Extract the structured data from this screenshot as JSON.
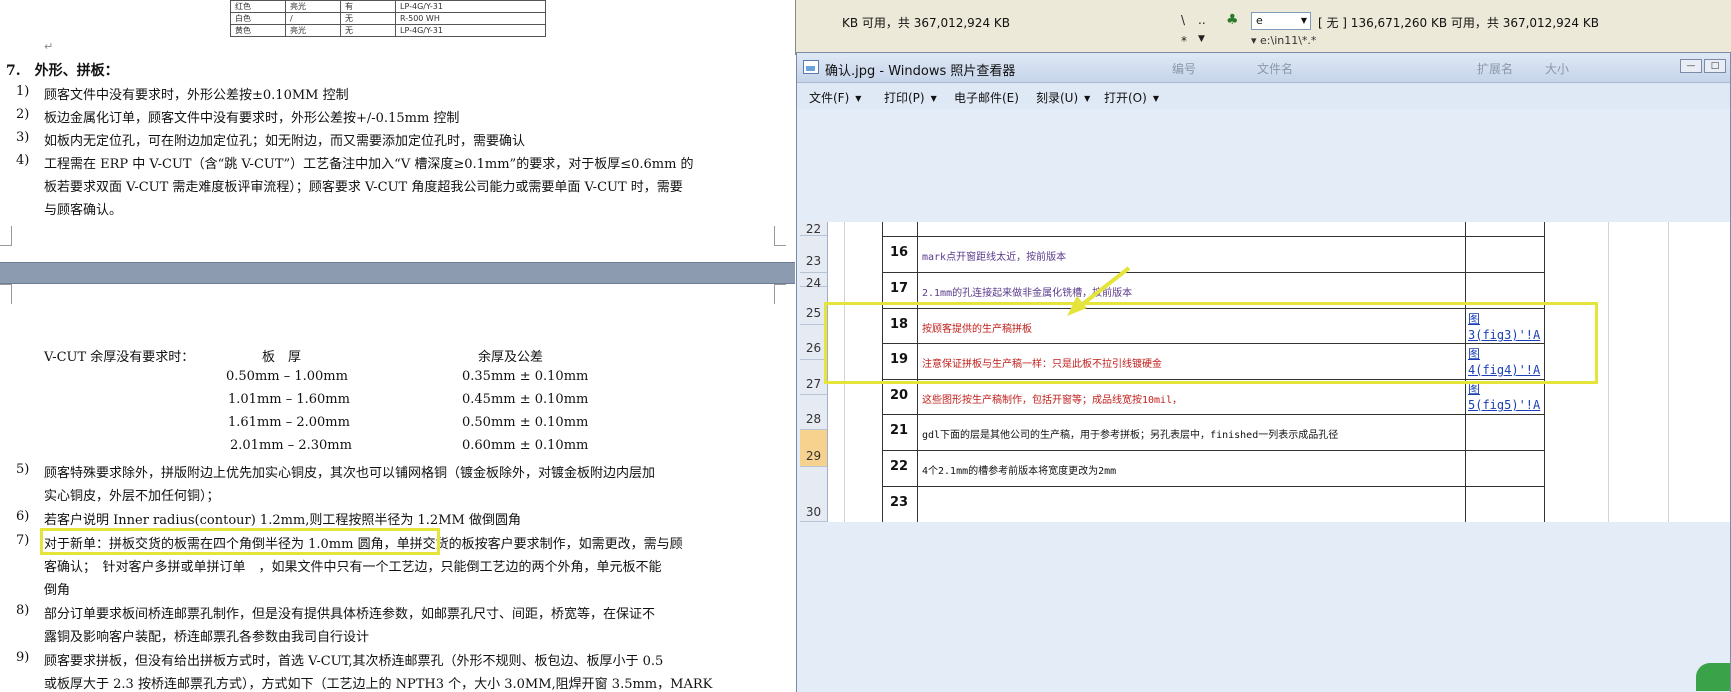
{
  "document": {
    "mini_table_rows": [
      [
        "红色",
        "亮光",
        "有",
        "LP-4G/Y-31"
      ],
      [
        "白色",
        "/",
        "无",
        "R-500 WH"
      ],
      [
        "黄色",
        "亮光",
        "无",
        "LP-4G/Y-31"
      ]
    ],
    "section7_heading": "7.　外形、拼板：",
    "items_top": [
      {
        "num": "1)",
        "text": "顾客文件中没有要求时，外形公差按±0.10MM 控制"
      },
      {
        "num": "2)",
        "text": "板边金属化订单，顾客文件中没有要求时，外形公差按+/-0.15mm 控制"
      },
      {
        "num": "3)",
        "text": "如板内无定位孔，可在附边加定位孔；如无附边，而又需要添加定位孔时，需要确认"
      },
      {
        "num": "4)",
        "text": "工程需在 ERP 中 V-CUT（含“跳 V-CUT”）工艺备注中加入“V 槽深度≥0.1mm”的要求，对于板厚≤0.6mm 的"
      },
      {
        "num": "",
        "text": "板若要求双面 V-CUT 需走难度板评审流程）；顾客要求 V-CUT 角度超我公司能力或需要单面 V-CUT 时，需要"
      },
      {
        "num": "",
        "text": "与顾客确认。"
      }
    ],
    "vcut": {
      "label": "V-CUT 余厚没有要求时：",
      "col1_header": "板　厚",
      "col2_header": "余厚及公差",
      "rows": [
        [
          "0.50mm – 1.00mm",
          "0.35mm ± 0.10mm"
        ],
        [
          "1.01mm – 1.60mm",
          "0.45mm ± 0.10mm"
        ],
        [
          "1.61mm – 2.00mm",
          "0.50mm ± 0.10mm"
        ],
        [
          "2.01mm – 2.30mm",
          "0.60mm ± 0.10mm"
        ]
      ]
    },
    "items_bottom": [
      {
        "num": "5)",
        "text": "顾客特殊要求除外，拼版附边上优先加实心铜皮，其次也可以铺网格铜（镀金板除外，对镀金板附边内层加"
      },
      {
        "num": "",
        "text": "实心铜皮，外层不加任何铜）；"
      },
      {
        "num": "6)",
        "text": "若客户说明 Inner radius(contour) 1.2mm,则工程按照半径为 1.2MM 做倒圆角"
      },
      {
        "num": "7)",
        "text": "对于新单：拼板交货的板需在四个角倒半径为 1.0mm 圆角，单拼交货的板按客户要求制作，如需更改，需与顾"
      },
      {
        "num": "",
        "text": "客确认；　针对客户多拼或单拼订单　，如果文件中只有一个工艺边，只能倒工艺边的两个外角，单元板不能"
      },
      {
        "num": "",
        "text": "倒角"
      },
      {
        "num": "8)",
        "text": "部分订单要求板间桥连邮票孔制作，但是没有提供具体桥连参数，如邮票孔尺寸、间距，桥宽等，在保证不"
      },
      {
        "num": "",
        "text": "露铜及影响客户装配，桥连邮票孔各参数由我司自行设计"
      },
      {
        "num": "9)",
        "text": "顾客要求拼板，但没有给出拼板方式时，首选 V-CUT,其次桥连邮票孔（外形不规则、板包边、板厚小于 0.5"
      },
      {
        "num": "",
        "text": "或板厚大于 2.3 按桥连邮票孔方式），方式如下（工艺边上的 NPTH3 个，大小 3.0MM,阻焊开窗 3.5mm，MARK"
      }
    ]
  },
  "file_manager": {
    "left_status": "KB 可用，共 367,012,924 KB",
    "btn_backslash": "\\",
    "btn_dotdot": "..",
    "btn_star": "*",
    "drive_value": "e",
    "right_status": "[ 无 ] 136,671,260 KB 可用，共 367,012,924 KB",
    "path": "▾ e:\\in11\\*.*"
  },
  "viewer": {
    "title": "确认.jpg - Windows 照片查看器",
    "blurred_tabs": [
      "编号",
      "文件名",
      "扩展名",
      "大小"
    ],
    "menu": [
      {
        "label": "文件(F)",
        "has_caret": true
      },
      {
        "label": "打印(P)",
        "has_caret": true
      },
      {
        "label": "电子邮件(E)",
        "has_caret": false
      },
      {
        "label": "刻录(U)",
        "has_caret": true
      },
      {
        "label": "打开(O)",
        "has_caret": true
      }
    ],
    "win_buttons": [
      "—",
      "□"
    ]
  },
  "sheet": {
    "row_headers": [
      "22",
      "23",
      "24",
      "25",
      "26",
      "27",
      "28",
      "29",
      "30"
    ],
    "active_row": "29",
    "rows": [
      {
        "num": "16",
        "text": "mark点开窗距线太近，按前版本",
        "color": "#5a3a8c",
        "link": ""
      },
      {
        "num": "17",
        "text": "2.1mm的孔连接起来做非金属化铣槽，按前版本",
        "color": "#5a3a8c",
        "link": ""
      },
      {
        "num": "18",
        "text": "按顾客提供的生产稿拼板",
        "color": "#c0201c",
        "link": "图\n3(fig3)'!A"
      },
      {
        "num": "19",
        "text": "注意保证拼板与生产稿一样：只是此板不拉引线镀硬金",
        "color": "#c0201c",
        "link": "图\n4(fig4)'!A"
      },
      {
        "num": "20",
        "text": "这些图形按生产稿制作，包括开窗等；成品线宽按10mil，",
        "color": "#c0201c",
        "link": "图\n5(fig5)'!A"
      },
      {
        "num": "21",
        "text": "gdl下面的层是其他公司的生产稿，用于参考拼板；另孔表层中，finished一列表示成品孔径",
        "color": "#111111",
        "link": ""
      },
      {
        "num": "22",
        "text": "4个2.1mm的槽参考前版本将宽度更改为2mm",
        "color": "#111111",
        "link": ""
      },
      {
        "num": "23",
        "text": "",
        "color": "#111111",
        "link": ""
      }
    ]
  },
  "colors": {
    "highlight": "#e5e43a",
    "link": "#1a3fb8",
    "red_text": "#c0201c",
    "purple_text": "#5a3a8c"
  }
}
